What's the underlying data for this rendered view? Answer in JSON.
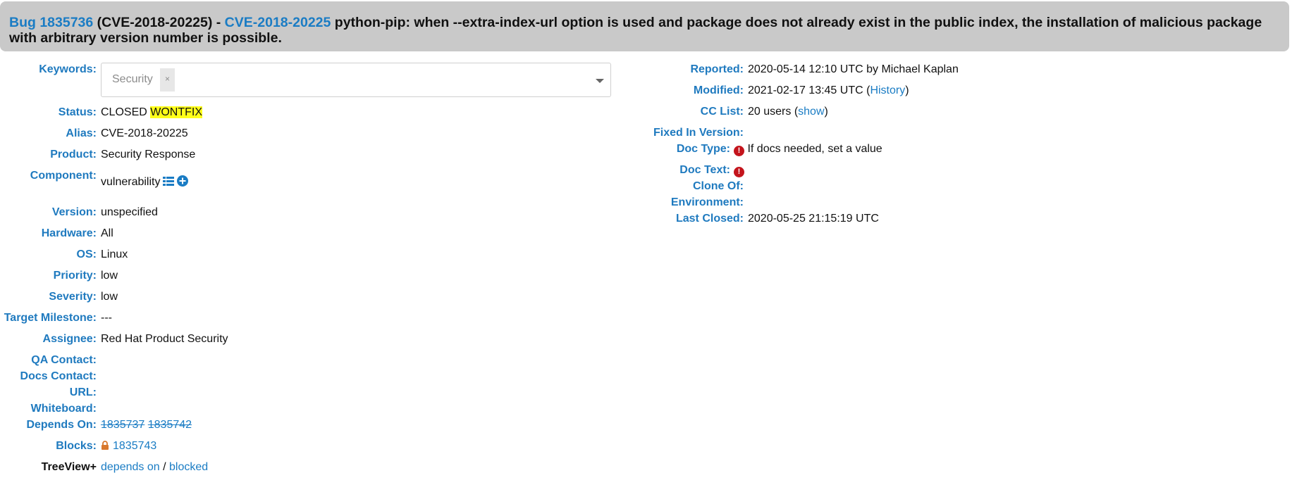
{
  "header": {
    "bug_link": "Bug 1835736",
    "alias_part": " (CVE-2018-20225) - ",
    "cve_link": "CVE-2018-20225",
    "summary": " python-pip: when --extra-index-url option is used and package does not already exist in the public index, the installation of malicious package with arbitrary version number is possible."
  },
  "fields": {
    "keywords": {
      "label": "Keywords:",
      "chip": "Security",
      "chip_remove": "×"
    },
    "status": {
      "label": "Status:",
      "value": "CLOSED",
      "resolution": "WONTFIX"
    },
    "alias": {
      "label": "Alias:",
      "value": "CVE-2018-20225"
    },
    "product": {
      "label": "Product:",
      "value": "Security Response"
    },
    "component": {
      "label": "Component:",
      "value": "vulnerability"
    },
    "version": {
      "label": "Version:",
      "value": "unspecified"
    },
    "hardware": {
      "label": "Hardware:",
      "value": "All"
    },
    "os": {
      "label": "OS:",
      "value": "Linux"
    },
    "priority": {
      "label": "Priority:",
      "value": "low"
    },
    "severity": {
      "label": "Severity:",
      "value": "low"
    },
    "target_milestone": {
      "label": "Target Milestone:",
      "value": "---"
    },
    "assignee": {
      "label": "Assignee:",
      "value": "Red Hat Product Security"
    },
    "qa_contact": {
      "label": "QA Contact:"
    },
    "docs_contact": {
      "label": "Docs Contact:"
    },
    "url": {
      "label": "URL:"
    },
    "whiteboard": {
      "label": "Whiteboard:"
    },
    "depends_on": {
      "label": "Depends On:",
      "items": [
        "1835737",
        "1835742"
      ]
    },
    "blocks": {
      "label": "Blocks:",
      "items": [
        "1835743"
      ]
    },
    "treeview": {
      "label": "TreeView+",
      "depends_link": "depends on",
      "separator": " / ",
      "blocked_link": "blocked"
    }
  },
  "right": {
    "reported": {
      "label": "Reported:",
      "value": "2020-05-14 12:10 UTC by Michael Kaplan"
    },
    "modified": {
      "label": "Modified:",
      "value": "2021-02-17 13:45 UTC (",
      "history_link": "History",
      "close": ")"
    },
    "cc_list": {
      "label": "CC List:",
      "value": "20 users (",
      "show_link": "show",
      "close": ")"
    },
    "fixed_in_version": {
      "label": "Fixed In Version:"
    },
    "doc_type": {
      "label": "Doc Type:",
      "value": "If docs needed, set a value"
    },
    "doc_text": {
      "label": "Doc Text:"
    },
    "clone_of": {
      "label": "Clone Of:"
    },
    "environment": {
      "label": "Environment:"
    },
    "last_closed": {
      "label": "Last Closed:",
      "value": "2020-05-25 21:15:19 UTC"
    }
  },
  "colors": {
    "link": "#1a7cc4",
    "label": "#1f7abf",
    "header_bg": "#c9c9c9",
    "highlight": "#ffff1a",
    "error_icon": "#c4141c"
  },
  "icons": [
    "list-icon",
    "plus-circle-icon",
    "lock-icon",
    "info-icon"
  ]
}
